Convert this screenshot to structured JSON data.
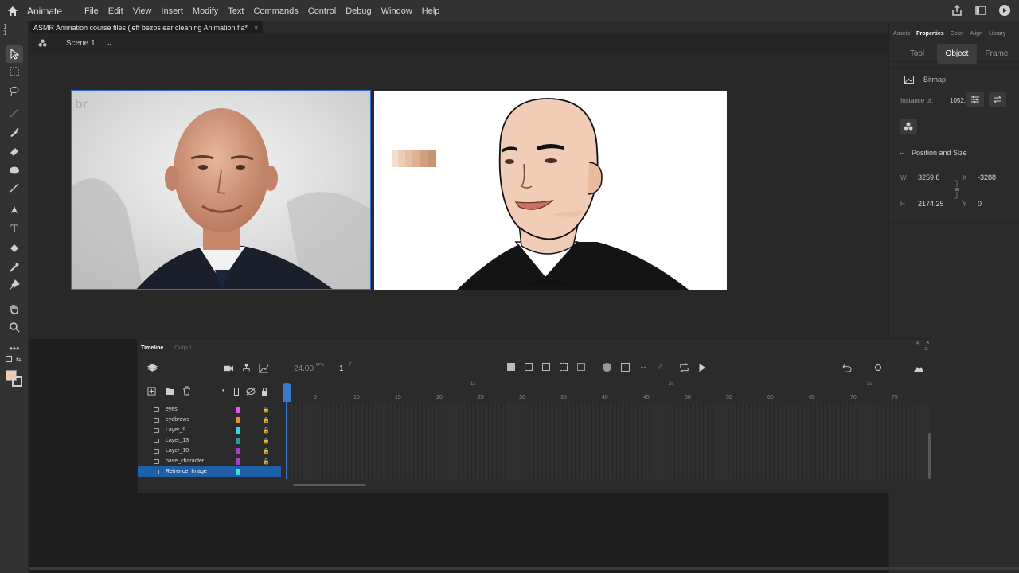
{
  "menubar": {
    "app_name": "Animate",
    "menus": [
      "File",
      "Edit",
      "View",
      "Insert",
      "Modify",
      "Text",
      "Commands",
      "Control",
      "Debug",
      "Window",
      "Help"
    ]
  },
  "toolbar": {
    "indicators": [
      "1",
      "1"
    ]
  },
  "document": {
    "tab_title": "ASMR Animation course files (jeff bezos ear cleaning Animation.fla*",
    "close_glyph": "×",
    "scene": "Scene 1"
  },
  "properties": {
    "tabs": [
      "Assets",
      "Properties",
      "Color",
      "Align",
      "Library"
    ],
    "active_tab": "Properties",
    "segments": [
      "Tool",
      "Object",
      "Frame"
    ],
    "active_segment": "Object",
    "object_type": "Bitmap",
    "instance_label": "Instance of:",
    "instance_value": "1052...",
    "section_title": "Position and Size",
    "w_label": "W",
    "w_value": "3259.8",
    "x_label": "X",
    "x_value": "-3288",
    "h_label": "H",
    "h_value": "2174.25",
    "y_label": "Y",
    "y_value": "0"
  },
  "timeline": {
    "tabs": [
      "Timeline",
      "Output"
    ],
    "fps_value": "24.00",
    "fps_unit": "FPS",
    "frame_value": "1",
    "frame_unit": "F",
    "ruler": [
      "5",
      "10",
      "15",
      "20",
      "25",
      "30",
      "35",
      "40",
      "45",
      "50",
      "55",
      "60",
      "65",
      "70",
      "75"
    ],
    "seconds_marks": [
      "1s",
      "2s",
      "3s"
    ],
    "layers": [
      {
        "name": "eyes",
        "color": "#e65ce6",
        "locked": true,
        "selected": false
      },
      {
        "name": "eyebrows",
        "color": "#f08a30",
        "locked": true,
        "selected": false
      },
      {
        "name": "Layer_9",
        "color": "#38d6e0",
        "locked": true,
        "selected": false
      },
      {
        "name": "Layer_13",
        "color": "#1fa3a3",
        "locked": true,
        "selected": false
      },
      {
        "name": "Layer_10",
        "color": "#a23fc9",
        "locked": true,
        "selected": false
      },
      {
        "name": "base_character",
        "color": "#a23fc9",
        "locked": true,
        "selected": false
      },
      {
        "name": "Refrence_Image",
        "color": "#38e0e0",
        "locked": false,
        "selected": true
      }
    ]
  },
  "colors": {
    "accent": "#2f6bd0",
    "selected_layer": "#1f5fa8",
    "fill_swatch": "#f3c9b0",
    "palette": [
      "#f6dccc",
      "#eecdb6",
      "#e6bfa4",
      "#ddb194",
      "#d1a080",
      "#c99470"
    ]
  }
}
